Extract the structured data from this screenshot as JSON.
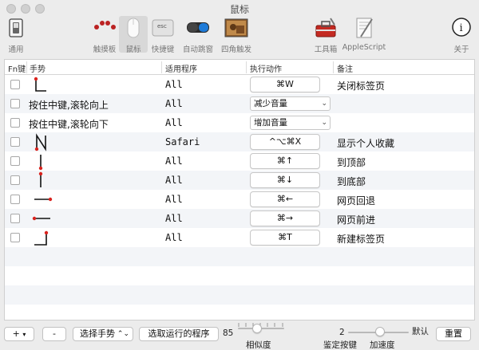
{
  "window": {
    "title": "鼠标"
  },
  "toolbar": {
    "items": [
      {
        "label": "通用",
        "icon": "general-switch-icon"
      },
      {
        "label": "触摸板",
        "icon": "trackpad-dots-icon"
      },
      {
        "label": "鼠标",
        "icon": "mouse-icon",
        "active": true
      },
      {
        "label": "快捷键",
        "icon": "esc-key-icon"
      },
      {
        "label": "自动跳窗",
        "icon": "toggle-switch-icon"
      },
      {
        "label": "四角触发",
        "icon": "hot-corners-icon"
      },
      {
        "label": "工具箱",
        "icon": "toolbox-icon"
      },
      {
        "label": "AppleScript",
        "icon": "applescript-icon"
      },
      {
        "label": "关于",
        "icon": "info-icon"
      }
    ]
  },
  "table": {
    "columns": {
      "fn": "Fn键",
      "gesture": "手势",
      "app": "适用程序",
      "action": "执行动作",
      "note": "备注"
    },
    "rows": [
      {
        "gesture_type": "draw",
        "gesture_icon": "down-right-gesture-icon",
        "app": "All",
        "action": "⌘W",
        "action_kind": "button",
        "note": "关闭标签页"
      },
      {
        "gesture_type": "text",
        "gesture_text": "按住中键,滚轮向上",
        "app": "All",
        "action": "减少音量",
        "action_kind": "select",
        "note": ""
      },
      {
        "gesture_type": "text",
        "gesture_text": "按住中键,滚轮向下",
        "app": "All",
        "action": "增加音量",
        "action_kind": "select",
        "note": ""
      },
      {
        "gesture_type": "draw",
        "gesture_icon": "n-zigzag-gesture-icon",
        "app": "Safari",
        "action": "^⌥⌘X",
        "action_kind": "button",
        "note": "显示个人收藏"
      },
      {
        "gesture_type": "draw",
        "gesture_icon": "up-gesture-icon",
        "app": "All",
        "action": "⌘↑",
        "action_kind": "button",
        "note": "到顶部"
      },
      {
        "gesture_type": "draw",
        "gesture_icon": "down-gesture-icon",
        "app": "All",
        "action": "⌘↓",
        "action_kind": "button",
        "note": "到底部"
      },
      {
        "gesture_type": "draw",
        "gesture_icon": "left-gesture-icon",
        "app": "All",
        "action": "⌘←",
        "action_kind": "button",
        "note": "网页回退"
      },
      {
        "gesture_type": "draw",
        "gesture_icon": "right-gesture-icon",
        "app": "All",
        "action": "⌘→",
        "action_kind": "button",
        "note": "网页前进"
      },
      {
        "gesture_type": "draw",
        "gesture_icon": "up-left-gesture-icon",
        "app": "All",
        "action": "⌘T",
        "action_kind": "button",
        "note": "新建标签页"
      }
    ]
  },
  "bottom": {
    "add": "+",
    "add_arrow": "▾",
    "remove": "-",
    "choose_gesture": "选择手势",
    "choose_running_app": "选取运行的程序",
    "similarity_value": "85",
    "similarity_label": "相似度",
    "key_value": "2",
    "key_label": "鉴定按键",
    "default_label": "默认",
    "speed_label": "加速度",
    "reset": "重置"
  },
  "colors": {
    "gesture_dot": "#d9231e",
    "row_alt": "#f3f5f8"
  }
}
